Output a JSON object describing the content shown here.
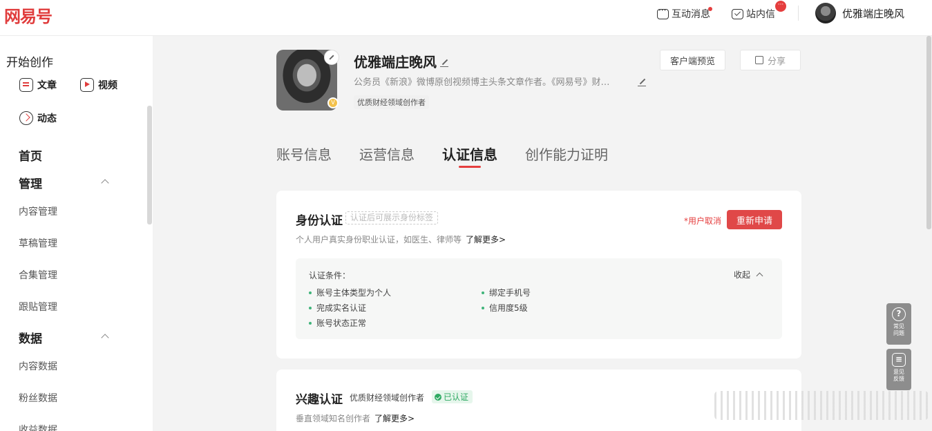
{
  "header": {
    "logo": "网易号",
    "interactions_label": "互动消息",
    "inbox_label": "站内信",
    "inbox_badge": "···",
    "username": "优雅端庄晚风"
  },
  "sidebar": {
    "create_title": "开始创作",
    "create_items": [
      {
        "label": "文章",
        "icon": "article-icon"
      },
      {
        "label": "视频",
        "icon": "video-icon"
      },
      {
        "label": "动态",
        "icon": "dynamic-icon"
      }
    ],
    "home": "首页",
    "manage_title": "管理",
    "manage_items": [
      "内容管理",
      "草稿管理",
      "合集管理",
      "跟贴管理"
    ],
    "data_title": "数据",
    "data_items": [
      "内容数据",
      "粉丝数据",
      "收益数据"
    ]
  },
  "profile": {
    "name": "优雅端庄晚风",
    "bio": "公务员《新浪》微博原创视频博主头条文章作者。《网易号》财…",
    "tag": "优质财经领域创作者",
    "preview_button": "客户端预览",
    "share_button": "分享"
  },
  "tabs": [
    {
      "label": "账号信息",
      "active": false
    },
    {
      "label": "运营信息",
      "active": false
    },
    {
      "label": "认证信息",
      "active": true
    },
    {
      "label": "创作能力证明",
      "active": false
    }
  ],
  "identity_card": {
    "title": "身份认证",
    "placeholder_tag": "认证后可展示身份标签",
    "description": "个人用户真实身份职业认证，如医生、律师等",
    "learn_more": "了解更多>",
    "status_text": "*用户取消",
    "reapply_button": "重新申请",
    "conditions_title": "认证条件：",
    "collapse_label": "收起",
    "conditions_left": [
      "账号主体类型为个人",
      "完成实名认证",
      "账号状态正常"
    ],
    "conditions_right": [
      "绑定手机号",
      "信用度5级"
    ]
  },
  "interest_card": {
    "title": "兴趣认证",
    "label": "优质财经领域创作者",
    "verified_badge": "已认证",
    "description": "垂直领域知名创作者",
    "learn_more": "了解更多>"
  },
  "floating": {
    "faq_label": "常见问题",
    "feedback_label": "意见反馈"
  },
  "colors": {
    "brand_red": "#e03c3c",
    "verified_green": "#2eaa62"
  }
}
